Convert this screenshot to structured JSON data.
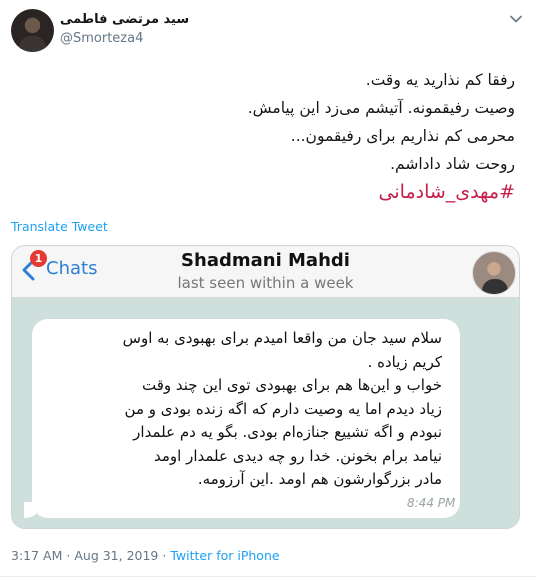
{
  "author": {
    "display_name": "سید مرتضی فاطمی",
    "handle": "@Smorteza4"
  },
  "tweet": {
    "lines": [
      "رفقا کم نذارید یه وقت.",
      "وصیت رفیقمونه. آتیشم می‌زد این پیامش.",
      "محرمی کم نذاریم برای رفیقمون...",
      "روحت شاد داداشم."
    ],
    "hashtag": "#مهدی_شادمانی"
  },
  "translate_label": "Translate Tweet",
  "media": {
    "back_label": "Chats",
    "unread_badge": "1",
    "contact_name": "Shadmani Mahdi",
    "contact_status": "last seen within a week",
    "message_lines": [
      "سلام سید جان من واقعا امیدم برای بهبودی به اوس",
      "کریم زیاده .",
      "خواب و این‌ها هم برای بهبودی توی این چند وقت",
      "زیاد دیدم اما یه وصیت دارم که اگه زنده بودی و من",
      "نبودم و اگه تشییع جنازه‌ام بودی. بگو یه دم علمدار",
      "نیامد برام بخونن.  خدا رو چه دیدی علمدار اومد",
      "مادر بزرگوارشون هم اومد .این آرزومه."
    ],
    "message_time": "8:44 PM"
  },
  "meta": {
    "time": "3:17 AM",
    "separator": "·",
    "date": "Aug 31, 2019",
    "source": "Twitter for iPhone"
  },
  "colors": {
    "link": "#1da1f2",
    "hashtag": "#c4204a",
    "chat_background": "#cfe0dc",
    "badge": "#e53935"
  }
}
